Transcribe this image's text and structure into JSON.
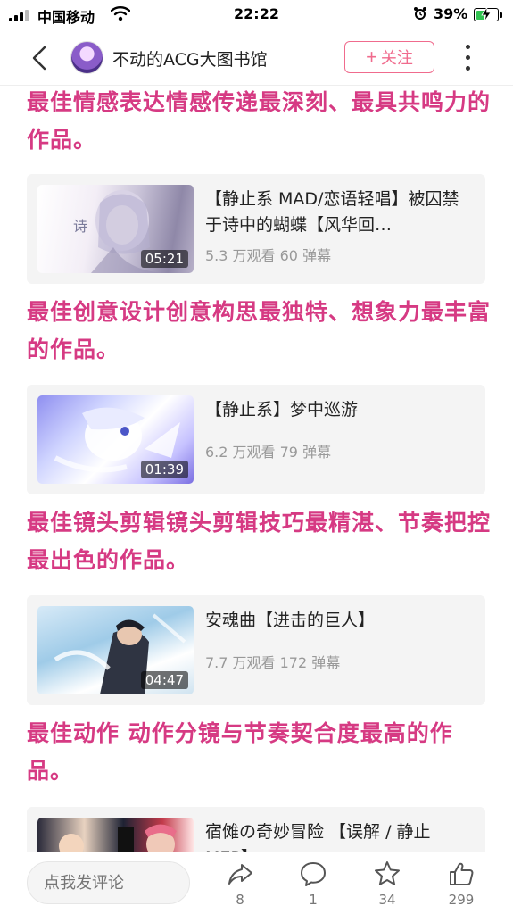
{
  "status_bar": {
    "carrier": "中国移动",
    "time": "22:22",
    "battery": "39%"
  },
  "nav": {
    "title": "不动的ACG大图书馆",
    "follow_label": "关注"
  },
  "awards": [
    "最佳情感表达情感传递最深刻、最具共鸣力的作品。",
    "最佳创意设计创意构思最独特、想象力最丰富的作品。",
    "最佳镜头剪辑镜头剪辑技巧最精湛、节奏把控最出色的作品。",
    "最佳动作  动作分镜与节奏契合度最高的作品。"
  ],
  "videos": [
    {
      "title": "【静止系 MAD/恋语轻唱】被囚禁于诗中的蝴蝶【风华回…",
      "stats": "5.3 万观看 60 弹幕",
      "duration": "05:21"
    },
    {
      "title": "【静止系】梦中巡游",
      "stats": "6.2 万观看 79 弹幕",
      "duration": "01:39"
    },
    {
      "title": "安魂曲【进击的巨人】",
      "stats": "7.7 万观看 172 弹幕",
      "duration": "04:47"
    },
    {
      "title": "宿傩の奇妙冒险 【误解 / 静止 MEP】",
      "stats": "",
      "duration": ""
    }
  ],
  "bottom_bar": {
    "comment_placeholder": "点我发评论",
    "share_count": "8",
    "comment_count": "1",
    "favorite_count": "34",
    "like_count": "299"
  },
  "icons": {
    "back": "chevron-left-icon",
    "more": "vertical-dots-icon",
    "share": "share-arrow-icon",
    "comment": "speech-bubble-icon",
    "favorite": "star-icon",
    "like": "thumbs-up-icon"
  },
  "colors": {
    "accent": "#d63a83",
    "follow": "#f06b8d"
  }
}
